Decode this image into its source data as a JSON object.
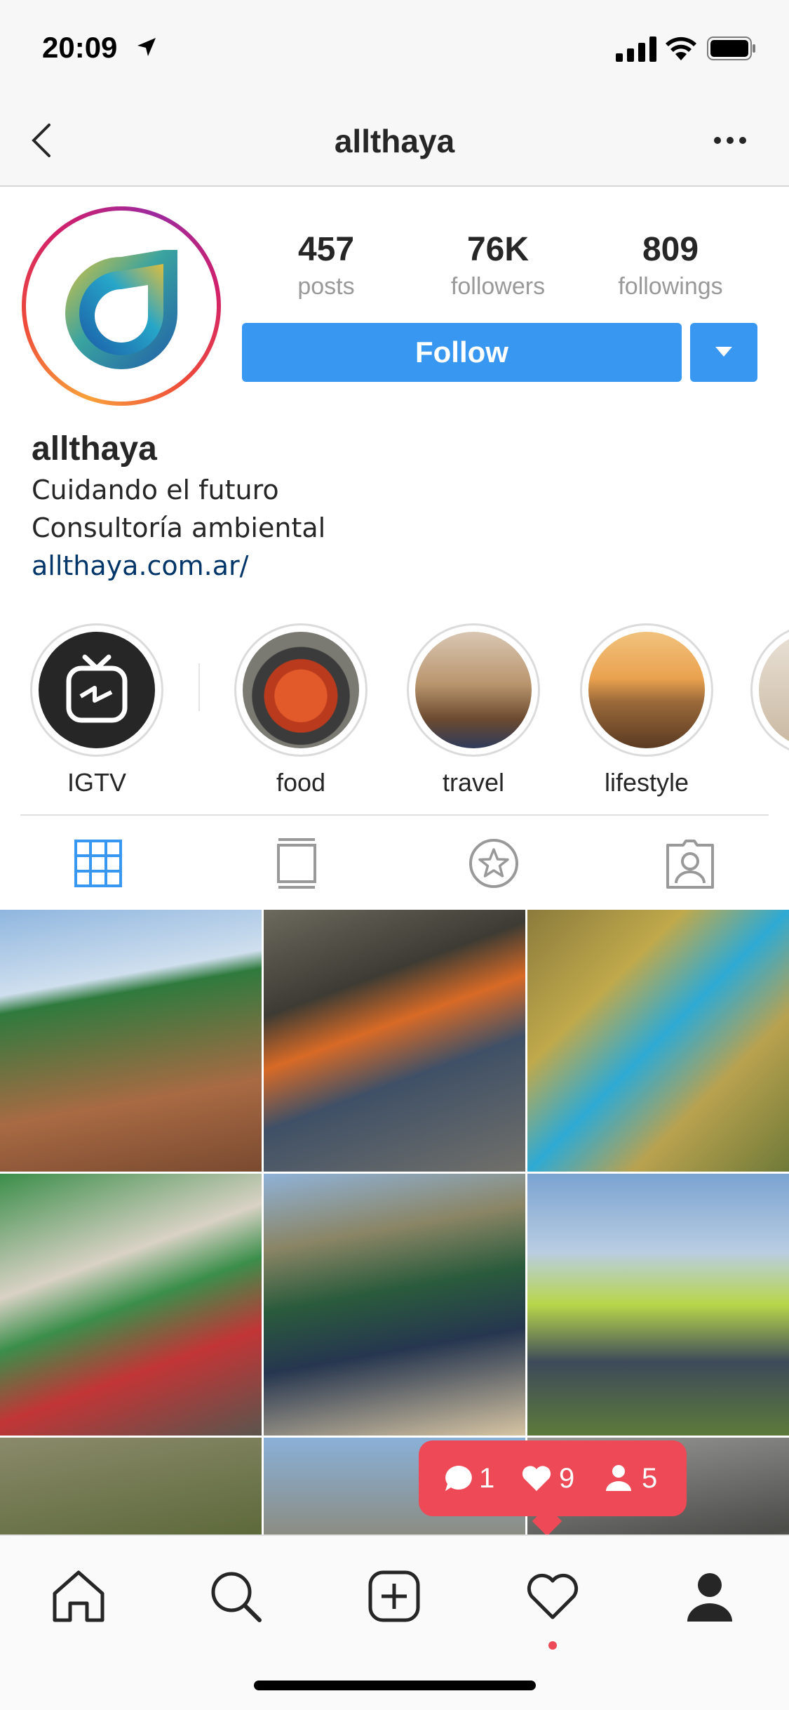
{
  "status_bar": {
    "time": "20:09"
  },
  "nav": {
    "title": "allthaya"
  },
  "profile": {
    "stats": [
      {
        "value": "457",
        "label": "posts"
      },
      {
        "value": "76K",
        "label": "followers"
      },
      {
        "value": "809",
        "label": "followings"
      }
    ],
    "follow_label": "Follow",
    "name": "allthaya",
    "bio_lines": [
      "Cuidando el futuro",
      "Consultoría ambiental"
    ],
    "link": "allthaya.com.ar/"
  },
  "highlights": [
    {
      "label": "IGTV",
      "icon": "igtv-icon"
    },
    {
      "label": "food"
    },
    {
      "label": "travel"
    },
    {
      "label": "lifestyle"
    }
  ],
  "tabs": [
    {
      "name": "grid",
      "icon": "grid-icon",
      "active": true
    },
    {
      "name": "feed",
      "icon": "feed-icon"
    },
    {
      "name": "saved",
      "icon": "star-circle-icon"
    },
    {
      "name": "tagged",
      "icon": "tagged-person-icon"
    }
  ],
  "notifications": {
    "comments": "1",
    "likes": "9",
    "follows": "5"
  },
  "tabbar": [
    {
      "icon": "home-icon"
    },
    {
      "icon": "search-icon"
    },
    {
      "icon": "add-post-icon"
    },
    {
      "icon": "activity-heart-icon"
    },
    {
      "icon": "profile-icon"
    }
  ],
  "colors": {
    "accent": "#3897f0",
    "notification": "#ed4956",
    "link": "#003569"
  }
}
